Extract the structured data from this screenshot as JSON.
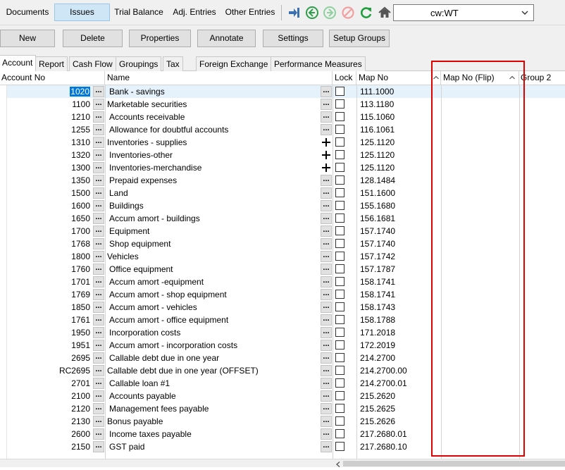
{
  "nav": {
    "tabs": [
      "Documents",
      "Issues",
      "Trial Balance",
      "Adj. Entries",
      "Other Entries"
    ],
    "active_tab": "Issues",
    "toolbar_icons": [
      "import-arrow-icon",
      "back-circle-icon",
      "forward-circle-icon",
      "cancel-icon",
      "refresh-icon",
      "home-icon"
    ],
    "client_select": "cw:WT"
  },
  "actions": {
    "new": "New",
    "delete": "Delete",
    "properties": "Properties",
    "annotate": "Annotate",
    "settings": "Settings",
    "setup_groups": "Setup Groups"
  },
  "subtabs": [
    "Account",
    "Report",
    "Cash Flow",
    "Groupings",
    "Tax",
    "Foreign Exchange",
    "Performance Measures"
  ],
  "grid": {
    "columns": {
      "account_no": "Account No",
      "name": "Name",
      "lock": "Lock",
      "map_no": "Map No",
      "map_no_flip": "Map No (Flip)",
      "group2": "Group 2"
    },
    "rows": [
      {
        "acct": "1020",
        "name": "Bank - savings",
        "map": "111.1000"
      },
      {
        "acct": "1100",
        "name": "Marketable securities",
        "map": "113.1180"
      },
      {
        "acct": "1210",
        "name": "Accounts receivable",
        "map": "115.1060"
      },
      {
        "acct": "1255",
        "name": "Allowance for doubtful accounts",
        "map": "116.1061"
      },
      {
        "acct": "1310",
        "name": "Inventories - supplies",
        "map": "125.1120"
      },
      {
        "acct": "1320",
        "name": "Inventories-other",
        "map": "125.1120"
      },
      {
        "acct": "1300",
        "name": "Inventories-merchandise",
        "map": "125.1120"
      },
      {
        "acct": "1350",
        "name": "Prepaid expenses",
        "map": "128.1484"
      },
      {
        "acct": "1500",
        "name": "Land",
        "map": "151.1600"
      },
      {
        "acct": "1600",
        "name": "Buildings",
        "map": "155.1680"
      },
      {
        "acct": "1650",
        "name": "Accum amort - buildings",
        "map": "156.1681"
      },
      {
        "acct": "1700",
        "name": "Equipment",
        "map": "157.1740"
      },
      {
        "acct": "1768",
        "name": "Shop equipment",
        "map": "157.1740"
      },
      {
        "acct": "1800",
        "name": "Vehicles",
        "map": "157.1742"
      },
      {
        "acct": "1760",
        "name": "Office equipment",
        "map": "157.1787"
      },
      {
        "acct": "1701",
        "name": "Accum amort -equipment",
        "map": "158.1741"
      },
      {
        "acct": "1769",
        "name": "Accum amort - shop equipment",
        "map": "158.1741"
      },
      {
        "acct": "1850",
        "name": "Accum amort - vehicles",
        "map": "158.1743"
      },
      {
        "acct": "1761",
        "name": "Accum amort - office equipment",
        "map": "158.1788"
      },
      {
        "acct": "1950",
        "name": "Incorporation costs",
        "map": "171.2018"
      },
      {
        "acct": "1951",
        "name": "Accum amort - incorporation costs",
        "map": "172.2019"
      },
      {
        "acct": "2695",
        "name": "Callable debt due in one year",
        "map": "214.2700"
      },
      {
        "acct": "RC2695",
        "name": "Callable debt due in one year (OFFSET)",
        "map": "214.2700.00"
      },
      {
        "acct": "2701",
        "name": "Callable loan #1",
        "map": "214.2700.01"
      },
      {
        "acct": "2100",
        "name": "Accounts payable",
        "map": "215.2620"
      },
      {
        "acct": "2120",
        "name": "Management fees payable",
        "map": "215.2625"
      },
      {
        "acct": "2130",
        "name": "Bonus payable",
        "map": "215.2626"
      },
      {
        "acct": "2600",
        "name": "Income taxes payable",
        "map": "217.2680.01"
      },
      {
        "acct": "2150",
        "name": "GST paid",
        "map": "217.2680.10"
      }
    ]
  }
}
